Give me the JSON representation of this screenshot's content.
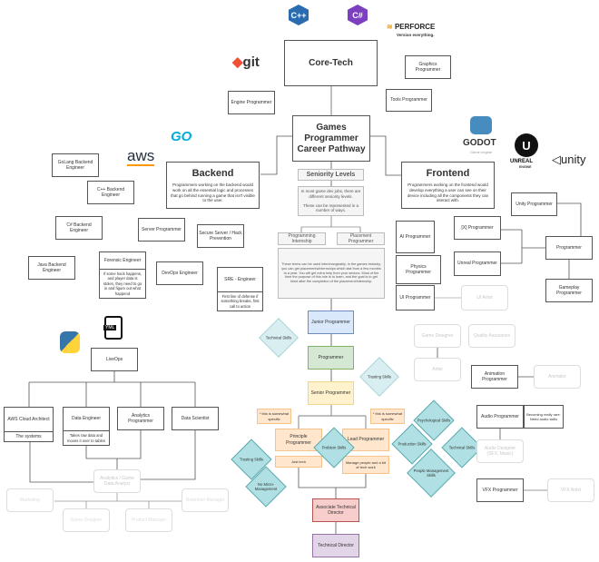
{
  "logos": {
    "cpp": "C++",
    "csharp": "C#",
    "perforce": "PERFORCE",
    "perforce_tag": "Version everything.",
    "git": "git",
    "go": "GO",
    "aws": "aws",
    "godot": "GODOT",
    "godot_tag": "Game engine",
    "unreal": "UNREAL",
    "unreal_tag": "ENGINE",
    "unity": "unity",
    "yml": "YML"
  },
  "core_tech": {
    "title": "Core-Tech",
    "graphics": "Graphics Programmer",
    "engine": "Engine Programmer",
    "tools": "Tools Programmer"
  },
  "pathway_title": "Games Programmer Career Pathway",
  "backend": {
    "title": "Backend",
    "desc": "Programmers working on the backend would work on all the essential logic and processes that go behind running a game that isn't visible to the user.",
    "golang": "GoLang Backend Engineer",
    "cpp": "C++ Backend Engineer",
    "csharp": "C# Backend Engineer",
    "server": "Server Programmer",
    "secure": "Secure Server / Hack Prevention",
    "java": "Java Backend Engineer",
    "forensic": "Forensic Engineer",
    "forensic_note": "If some hack happens, and player data is stolen, they need to go in and figure out what happend",
    "devops": "DevOps Engineer",
    "sre": "SRE - Engineer",
    "sre_note": "First line of defense if something breaks, first call to action"
  },
  "seniority": {
    "title": "Seniority Levels",
    "desc1": "In most game dev jobs, there are different seniority levels.",
    "desc2": "These can be represented in a number of ways.",
    "internship": "Programming Internship",
    "placement": "Placement Programmer",
    "note": "These terms can be used interchangeably. In the games industry, you can get placements/internships which last from a few months to a year. You will get extra help from your seniors. Most of the time the purpose of this role is to learn, and the goal is to get hired after the completion of the placement/internship."
  },
  "frontend": {
    "title": "Frontend",
    "desc": "Programmers working on the frontend would develop everything a user can see on their device including all the components they can interact with.",
    "unity": "Unity Programmer",
    "ai": "AI Programmer",
    "x": "[X] Programmer",
    "physics": "Physics Programmer",
    "unreal": "Unreal Programmer",
    "programmer": "Programmer",
    "gameplay": "Gameplay Programmer",
    "ui": "UI Programmer",
    "ui_artist": "UI Artist"
  },
  "ladder": {
    "junior": "Junior Programmer",
    "programmer": "Programmer",
    "senior": "Senior Programmer",
    "note_left": "* this is somewhat specific",
    "note_right": "* this is somewhat specific",
    "principle": "Principle Programmer",
    "principle_note": "Just tech",
    "lead": "Lead Programmer",
    "lead_note": "Manage people and a bit of tech work",
    "atd": "Associate Technical Director",
    "td": "Technical Director"
  },
  "skills": {
    "technical1": "Technical Skills",
    "trusting1": "Trusting Skills",
    "problem": "Problem Skills",
    "trusting2": "Trusting Skills",
    "no_micro": "No Micro-Management",
    "psych": "Psychological Skills",
    "production": "Production Skills",
    "technical2": "Technical Skills",
    "people": "People Management Skills"
  },
  "other": {
    "game_designer": "Game Designer",
    "qa": "Quality Assurance",
    "artist": "Artist",
    "animation": "Animation Programmer",
    "animator": "Animator",
    "audio": "Audio Programmer",
    "audio_note": "Becoming really rare. Need audio skills",
    "audio_designer": "Audio Designer (SFX, Music)",
    "vfx": "VFX Programmer",
    "vfx_artist": "VFX Artist"
  },
  "liveops": {
    "title": "LiveOps",
    "aws": "AWS Cloud Architect",
    "aws_note": "The systems",
    "data_eng": "Data Engineer",
    "data_eng_note": "Takes raw data and moves it over to tables",
    "analytics": "Analytics Programmer",
    "scientist": "Data Scientist",
    "analyst": "Analytics / Game Data Analyst",
    "marketing": "Marketing",
    "retention": "Retention Manager",
    "game_designer": "Game Designer",
    "product": "Product Manager"
  },
  "colors": {
    "junior": "#dae8fc",
    "programmer": "#d5e8d4",
    "senior": "#fff2cc",
    "orange": "#ffe6cc",
    "atd": "#f8cecc",
    "td": "#e1d5e7",
    "skill": "#b0e0e3"
  }
}
